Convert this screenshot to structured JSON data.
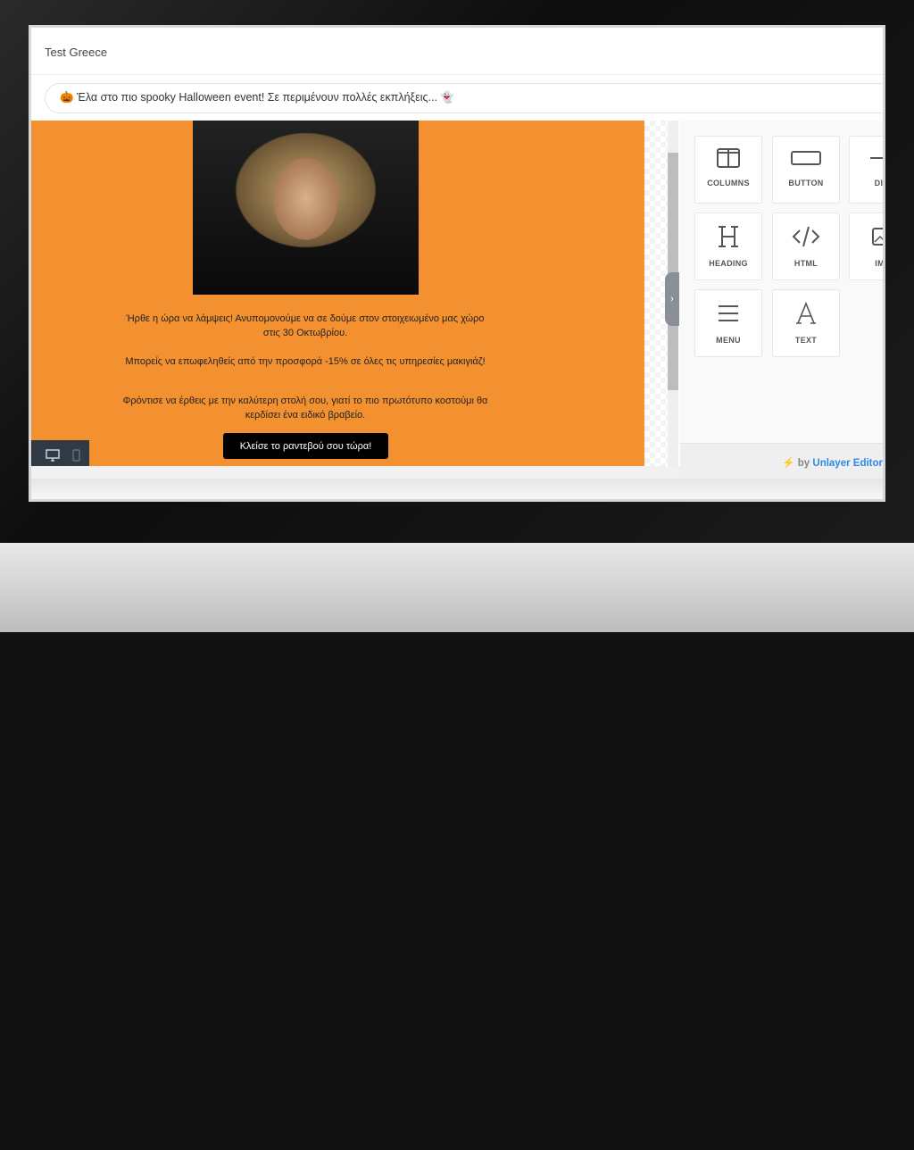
{
  "window": {
    "title": "Test Greece"
  },
  "subject": {
    "value": "🎃 Έλα στο πιο spooky Halloween event! Σε περιμένουν πολλές εκπλήξεις... 👻"
  },
  "email": {
    "paragraphs": [
      "Ήρθε η ώρα να λάμψεις! Ανυπομονούμε να σε δούμε στον στοιχειωμένο μας χώρο στις 30 Οκτωβρίου.",
      "Μπορείς να επωφεληθείς από την προσφορά -15% σε όλες τις υπηρεσίες μακιγιάζ!",
      "Φρόντισε να έρθεις με την καλύτερη στολή σου, γιατί το πιο πρωτότυπο κοστούμι θα κερδίσει ένα ειδικό βραβείο."
    ],
    "cta": "Κλείσε το ραντεβού σου τώρα!",
    "background": "#F39130"
  },
  "tools": [
    {
      "label": "COLUMNS",
      "icon": "columns-icon"
    },
    {
      "label": "BUTTON",
      "icon": "button-icon"
    },
    {
      "label": "DIVI",
      "icon": "divider-icon"
    },
    {
      "label": "HEADING",
      "icon": "heading-icon"
    },
    {
      "label": "HTML",
      "icon": "code-icon"
    },
    {
      "label": "IMA",
      "icon": "image-icon"
    },
    {
      "label": "MENU",
      "icon": "menu-icon"
    },
    {
      "label": "TEXT",
      "icon": "text-icon"
    }
  ],
  "footer": {
    "by": "by",
    "brand": "Unlayer Editor",
    "brand_color": "#2e8ae6"
  }
}
